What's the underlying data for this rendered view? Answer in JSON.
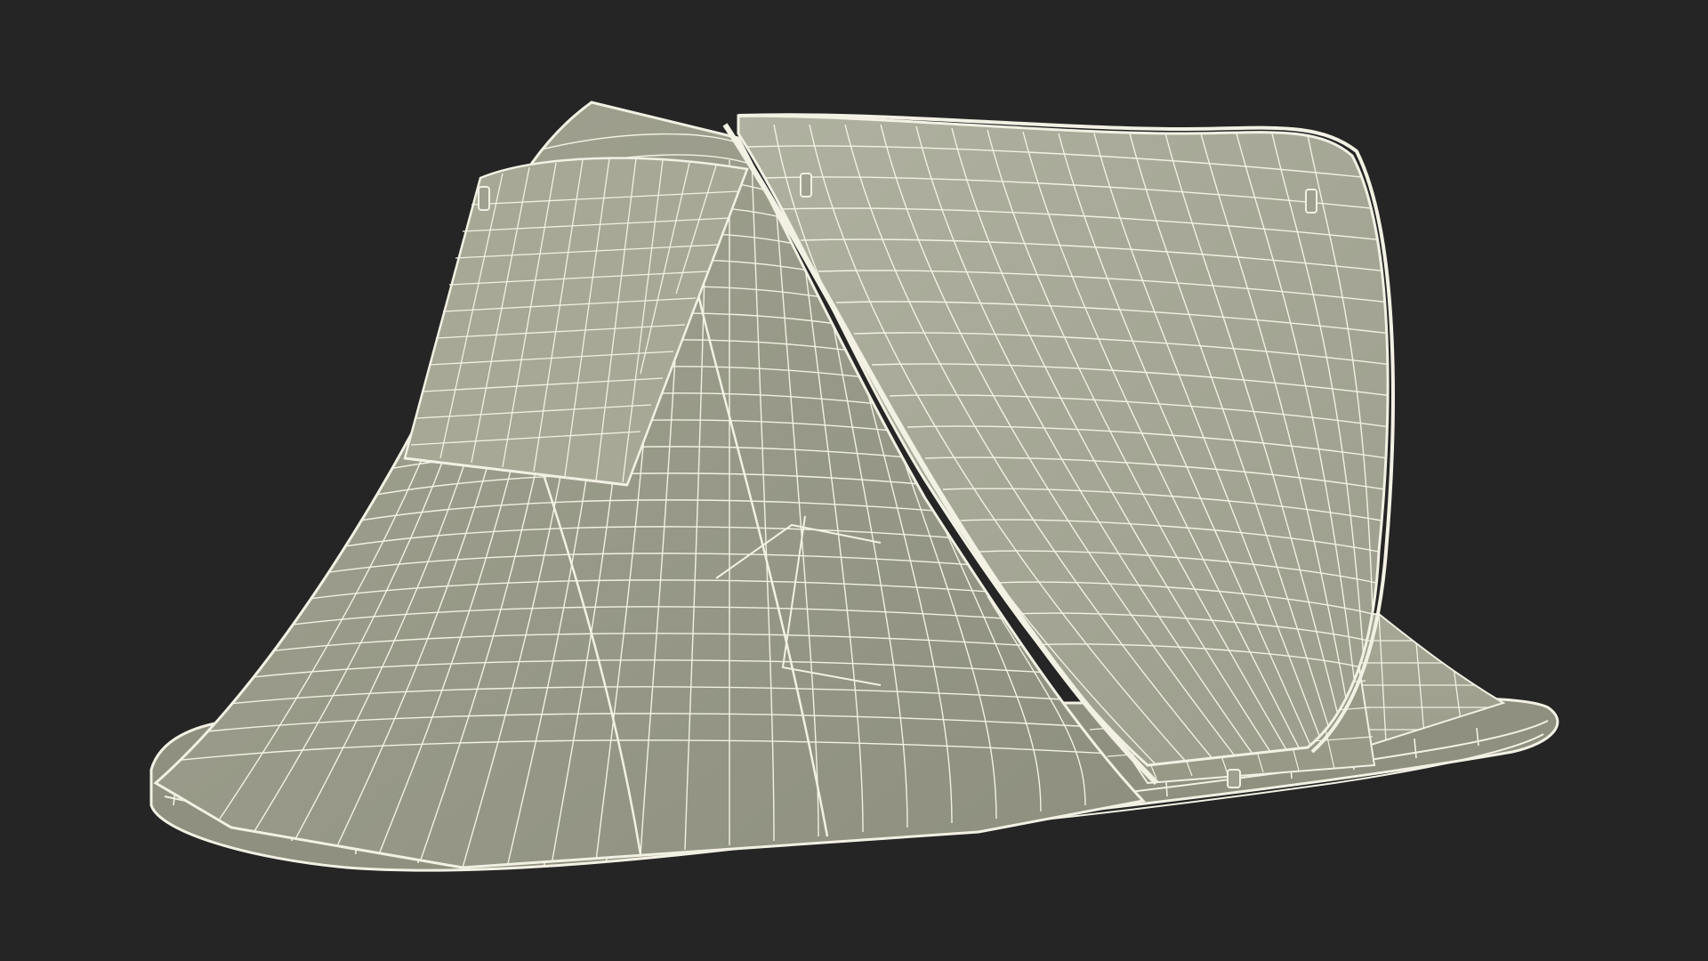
{
  "scene": {
    "subject": "tent-wireframe-render",
    "colors": {
      "background": "#252525",
      "fabric": "#a3a493",
      "fabric_shadow": "#8d8f7f",
      "fabric_light": "#b2b3a2",
      "wire": "#f2f1e4"
    }
  }
}
